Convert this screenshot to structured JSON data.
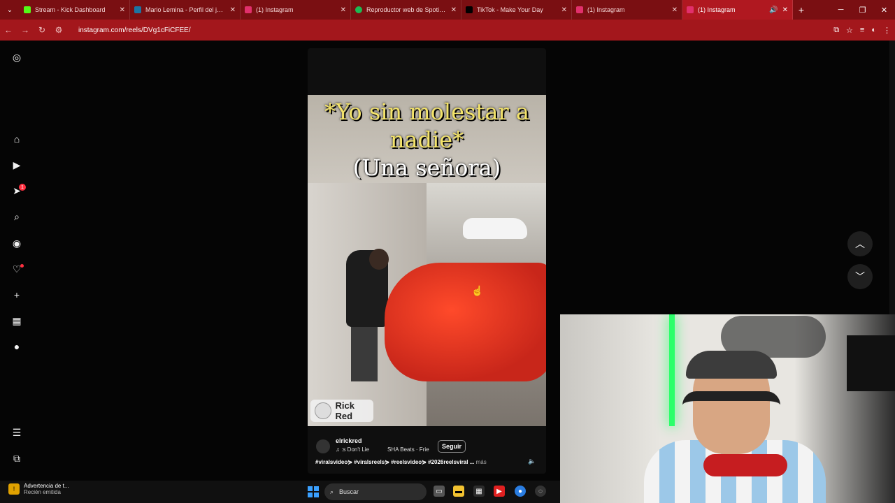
{
  "browser": {
    "tabs": [
      {
        "title": "Stream - Kick Dashboard",
        "icon": "kick-icon",
        "color": "#53fc18"
      },
      {
        "title": "Mario Lemina - Perfil del jugad",
        "icon": "transfermarkt-icon",
        "color": "#1d75a3"
      },
      {
        "title": "(1) Instagram",
        "icon": "instagram-icon",
        "color": "#e1306c"
      },
      {
        "title": "Reproductor web de Spotify: m",
        "icon": "spotify-icon",
        "color": "#1db954"
      },
      {
        "title": "TikTok - Make Your Day",
        "icon": "tiktok-icon",
        "color": "#000000"
      },
      {
        "title": "(1) Instagram",
        "icon": "instagram-icon",
        "color": "#e1306c"
      },
      {
        "title": "(1) Instagram",
        "icon": "instagram-icon",
        "color": "#e1306c"
      }
    ],
    "url": "instagram.com/reels/DVg1cFiCFEE/"
  },
  "reel": {
    "caption_top": "*Yo sin molestar a nadie*",
    "caption_sub": "(Una señora)",
    "watermark": "Rick Red",
    "username": "elrickred",
    "audio": "♫ :s Don't Lie",
    "audio2": "SHA Beats · Frie",
    "follow_label": "Seguir",
    "tags": "#viralsvideo⋟ #viralsreels⋟ #reelsvideo⋟ #2026reelsviral ...",
    "more_label": "más"
  },
  "notifications": {
    "unread": "1"
  },
  "taskbar": {
    "notif_title": "Advertencia de t...",
    "notif_sub": "Recién emitida",
    "search_placeholder": "Buscar"
  }
}
